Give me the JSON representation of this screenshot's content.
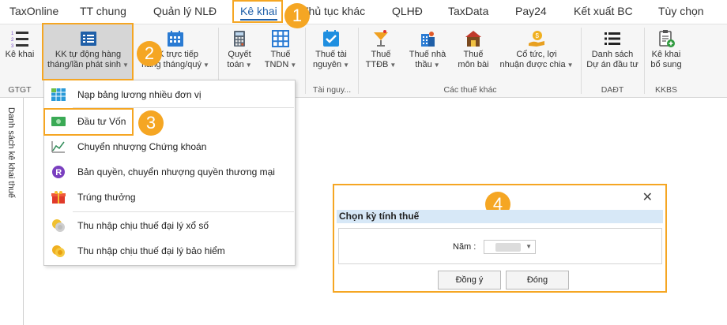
{
  "menubar": {
    "tabs": [
      "TaxOnline",
      "TT chung",
      "Quản lý NLĐ",
      "Kê khai",
      "Thủ tục khác",
      "QLHĐ",
      "TaxData",
      "Pay24",
      "Kết xuất BC",
      "Tùy chọn"
    ],
    "active": "Kê khai"
  },
  "ribbon": {
    "buttons": {
      "ke_khai": "Kê khai",
      "kk_tu_dong_1": "KK tự động hàng",
      "kk_tu_dong_2": "tháng/lần phát sinh",
      "kk_truc_tiep_1": "KK trực tiếp",
      "kk_truc_tiep_2": "hàng tháng/quý",
      "quyet_toan_1": "Quyết",
      "quyet_toan_2": "toán",
      "thue_tndn_1": "Thuế",
      "thue_tndn_2": "TNDN",
      "thue_tai_nguyen_1": "Thuế tài",
      "thue_tai_nguyen_2": "nguyên",
      "thue_ttdb_1": "Thuế",
      "thue_ttdb_2": "TTĐB",
      "thue_nha_thau_1": "Thuế nhà",
      "thue_nha_thau_2": "thầu",
      "thue_mon_bai_1": "Thuế",
      "thue_mon_bai_2": "môn bài",
      "co_tuc_1": "Cổ tức, lợi",
      "co_tuc_2": "nhuận được chia",
      "danh_sach_1": "Danh sách",
      "danh_sach_2": "Dự án đầu tư",
      "ke_khai_bs_1": "Kê khai",
      "ke_khai_bs_2": "bổ sung"
    },
    "groups": {
      "gtgt": "GTGT",
      "tai_nguyen": "Tài nguy...",
      "cac_thue_khac": "Các thuế khác",
      "dadt": "DAĐT",
      "kkbs": "KKBS"
    }
  },
  "sidebar": {
    "label": "Danh sách kê khai thuế"
  },
  "dropdown": {
    "items": [
      "Nạp bảng lương nhiều đơn vị",
      "Đầu tư Vốn",
      "Chuyển nhượng Chứng khoán",
      "Bản quyền, chuyển nhượng quyền thương mại",
      "Trúng thưởng",
      "Thu nhập chịu thuế đại lý xổ số",
      "Thu nhập chịu thuế đại lý bảo hiểm"
    ]
  },
  "badges": [
    "1",
    "2",
    "3",
    "4"
  ],
  "dialog": {
    "close": "✕",
    "title": "Chọn kỳ tính thuế",
    "year_label": "Năm :",
    "ok": "Đồng ý",
    "close_button": "Đóng"
  },
  "colors": {
    "accent": "#f5a623",
    "active_tab": "#1f5fa8",
    "dialog_title_bg": "#d7e8f7"
  }
}
